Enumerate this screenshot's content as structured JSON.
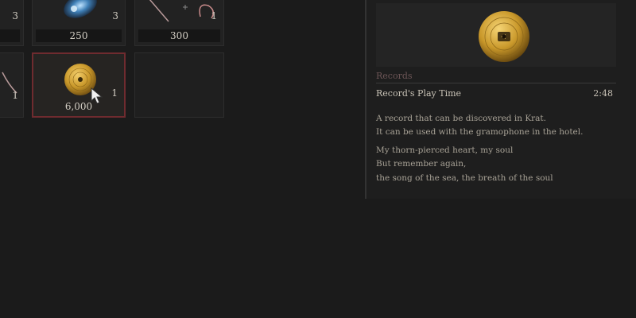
{
  "grid": {
    "slots": [
      {
        "name": "slot-top-left",
        "qty": "3",
        "price": ""
      },
      {
        "name": "slot-top-lantern",
        "qty": "3",
        "price": "250"
      },
      {
        "name": "slot-top-thread",
        "qty": "1",
        "price": "300"
      },
      {
        "name": "slot-mid-left",
        "qty": "1",
        "price": ""
      },
      {
        "name": "slot-record",
        "qty": "1",
        "price": "6,000"
      }
    ]
  },
  "detail": {
    "category": "Records",
    "stat_label": "Record's Play Time",
    "stat_value": "2:48",
    "description": [
      "A record that can be discovered in Krat.",
      "It can be used with the gramophone in the hotel."
    ],
    "lyrics": [
      "My thorn-pierced heart, my soul",
      "But remember again,",
      "the song of the sea, the breath of the soul"
    ]
  },
  "colors": {
    "selection_border": "#6f2b2f",
    "record_gold": "#c9982a",
    "category_text": "#6c5556"
  },
  "icons": [
    "gold-record-icon",
    "lantern-icon",
    "needle-thread-icon",
    "cursor-icon"
  ]
}
